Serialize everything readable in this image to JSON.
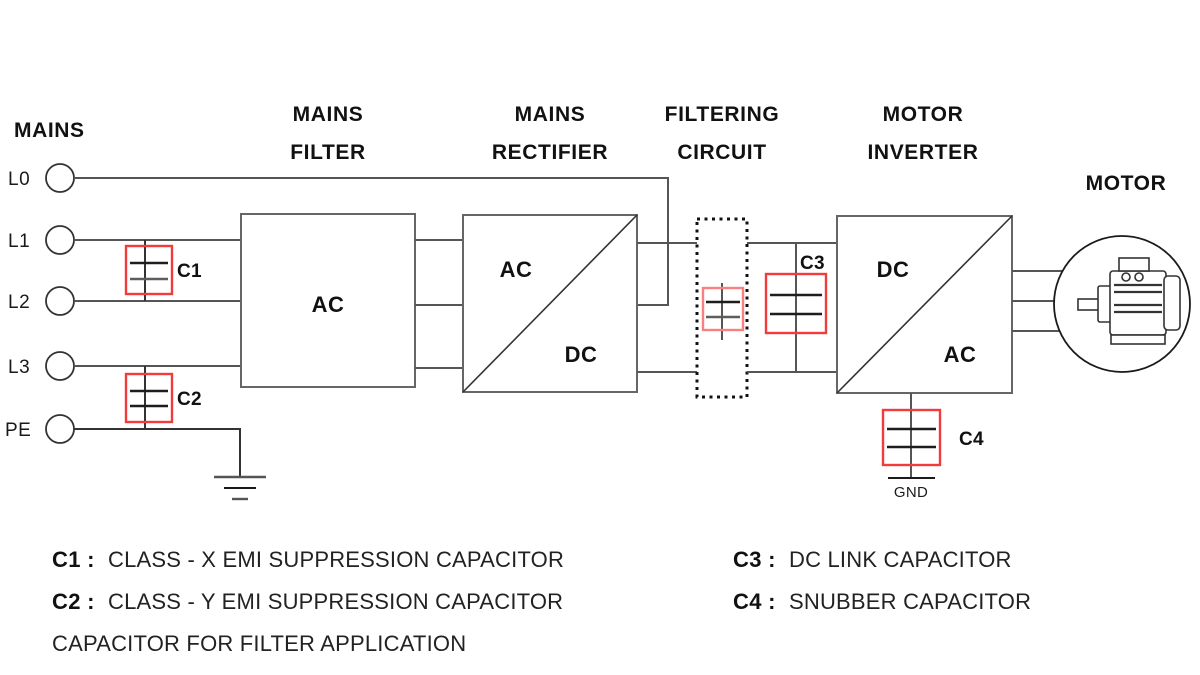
{
  "sections": {
    "mains": "MAINS",
    "mains_filter_l1": "MAINS",
    "mains_filter_l2": "FILTER",
    "mains_rectifier_l1": "MAINS",
    "mains_rectifier_l2": "RECTIFIER",
    "filtering_circuit_l1": "FILTERING",
    "filtering_circuit_l2": "CIRCUIT",
    "motor_inverter_l1": "MOTOR",
    "motor_inverter_l2": "INVERTER",
    "motor": "MOTOR"
  },
  "terminals": [
    {
      "label": "L0"
    },
    {
      "label": "L1"
    },
    {
      "label": "L2"
    },
    {
      "label": "L3"
    },
    {
      "label": "PE"
    }
  ],
  "blocks": {
    "mains_filter": {
      "label": "AC"
    },
    "mains_rectifier": {
      "top_label": "AC",
      "bottom_label": "DC"
    },
    "motor_inverter": {
      "top_label": "DC",
      "bottom_label": "AC"
    }
  },
  "capacitors": {
    "c1": "C1",
    "c2": "C2",
    "c3": "C3",
    "c4": "C4"
  },
  "gnd_label": "GND",
  "legend": {
    "left": [
      {
        "key": "C1 :",
        "text": "CLASS - X EMI SUPPRESSION CAPACITOR"
      },
      {
        "key": "C2 :",
        "text": "CLASS - Y EMI SUPPRESSION CAPACITOR"
      },
      {
        "key": "",
        "text": "CAPACITOR FOR FILTER APPLICATION"
      }
    ],
    "right": [
      {
        "key": "C3 :",
        "text": "DC LINK CAPACITOR"
      },
      {
        "key": "C4 :",
        "text": "SNUBBER CAPACITOR"
      }
    ]
  },
  "colors": {
    "accent_red": "#f23b3b",
    "accent_salmon": "#f98080",
    "wire": "#555555",
    "text": "#111111"
  }
}
